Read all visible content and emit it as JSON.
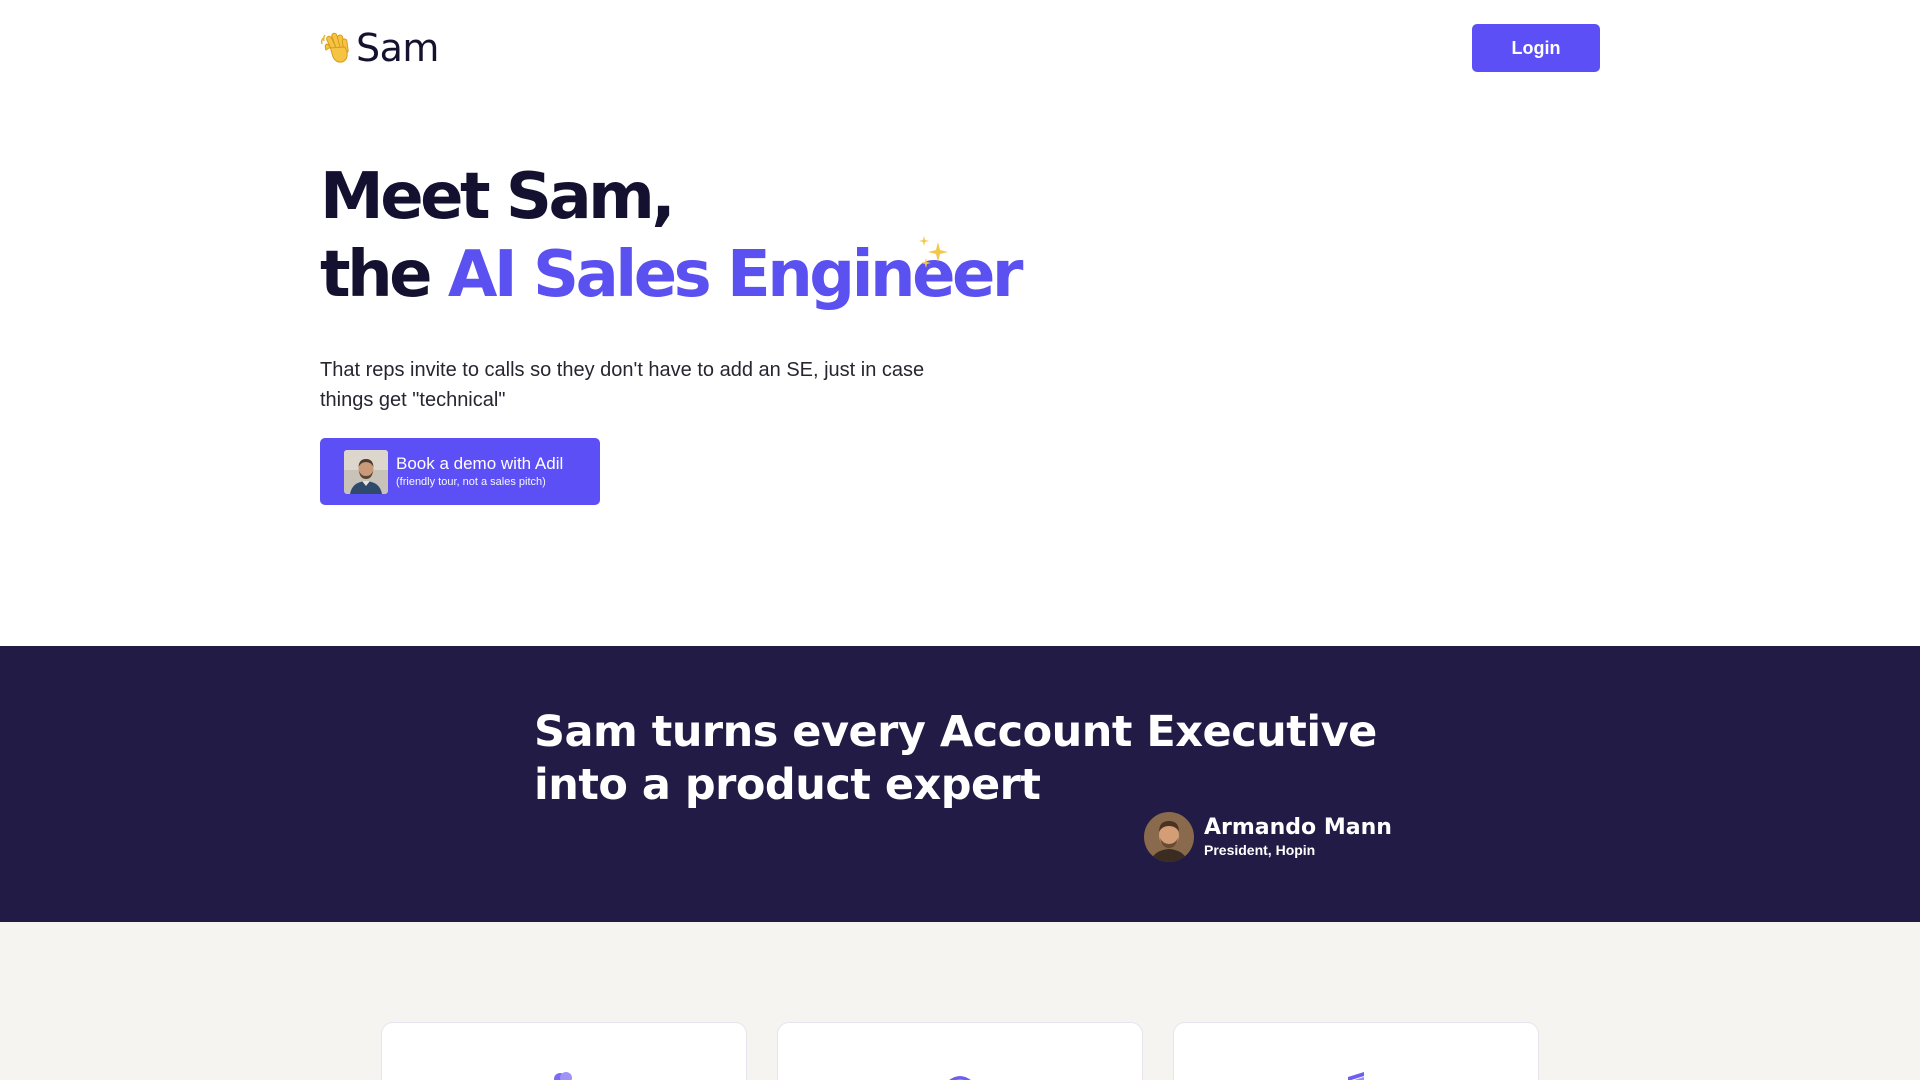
{
  "header": {
    "logo_text": "Sam",
    "login_label": "Login"
  },
  "hero": {
    "title_line1": "Meet Sam,",
    "title_line2_prefix": "the ",
    "title_line2_accent": "AI Sales Engineer",
    "subtitle": "That reps invite to calls so they don't have to add an SE, just in case things get \"technical\"",
    "demo_button": {
      "main": "Book a demo with Adil",
      "sub": "(friendly tour, not a sales pitch)"
    }
  },
  "testimonial": {
    "quote_line1": "Sam turns every Account Executive",
    "quote_line2": "into a product expert",
    "name": "Armando Mann",
    "role": "President, Hopin"
  },
  "colors": {
    "brand": "#5b4ff5",
    "accent_text": "#5b50f0",
    "dark_band": "#211b45",
    "features_bg": "#f6f4f1"
  },
  "icons": {
    "logo": "waving-hand-icon",
    "sparkles": "sparkles-icon"
  }
}
